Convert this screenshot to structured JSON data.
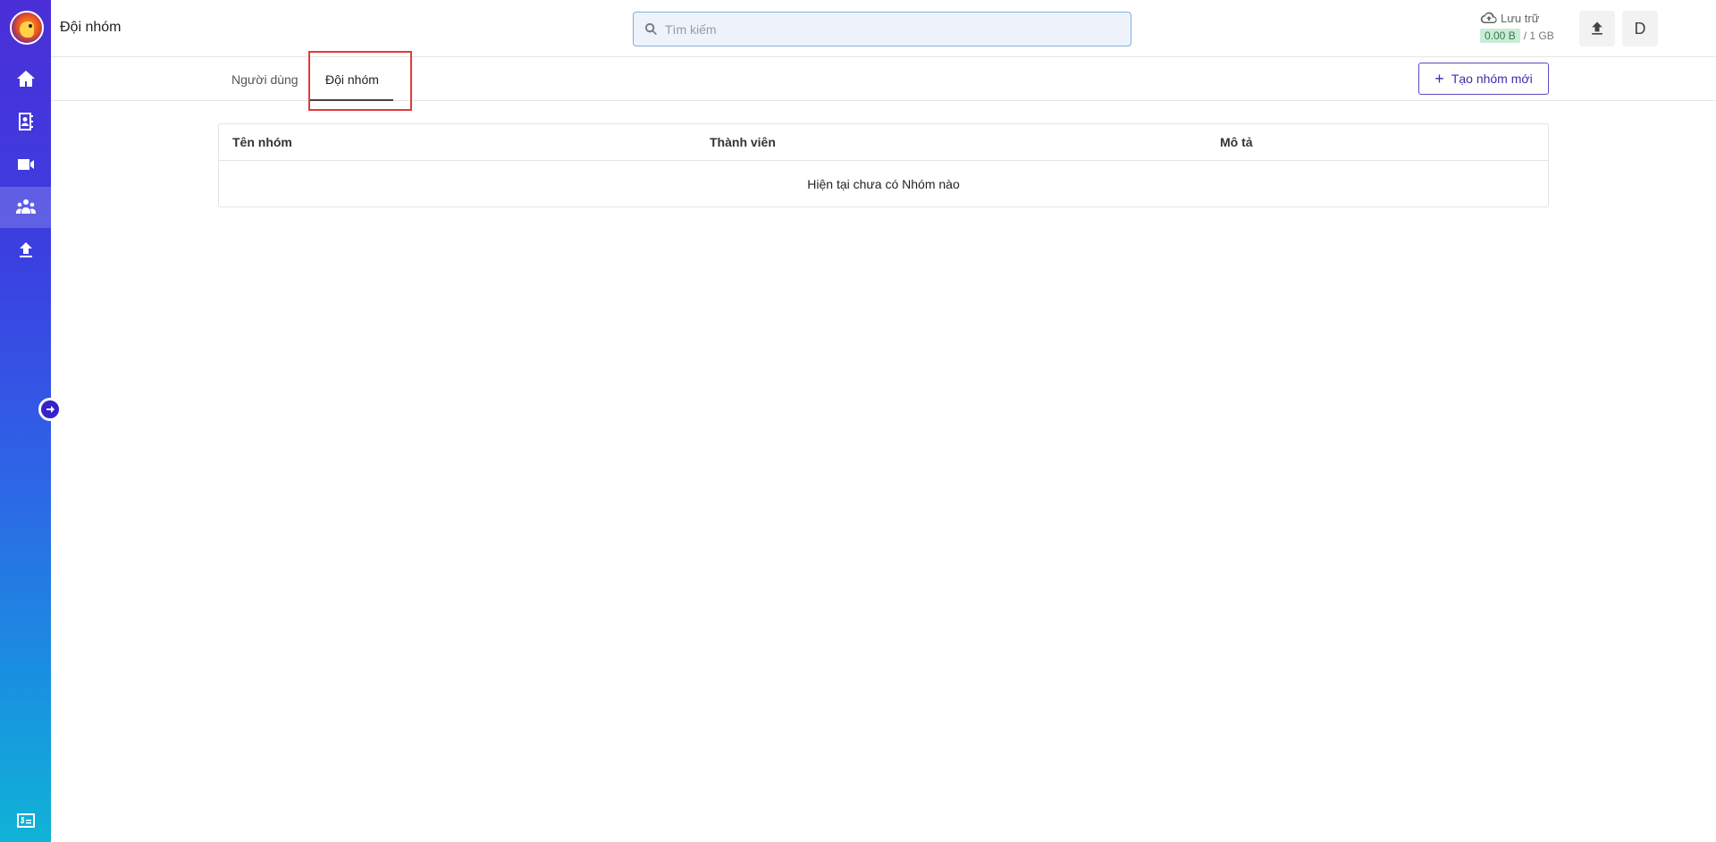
{
  "header": {
    "page_title": "Đội nhóm",
    "search_placeholder": "Tìm kiếm",
    "storage_label": "Lưu trữ",
    "storage_used": "0.00 B",
    "storage_total": "/ 1 GB",
    "avatar_letter": "D"
  },
  "sidebar": {
    "items": [
      {
        "icon": "home-icon"
      },
      {
        "icon": "contacts-icon"
      },
      {
        "icon": "video-camera-icon"
      },
      {
        "icon": "team-icon"
      },
      {
        "icon": "upload-icon"
      }
    ],
    "active_index": 3
  },
  "tabs": [
    {
      "label": "Người dùng"
    },
    {
      "label": "Đội nhóm"
    }
  ],
  "toolbar": {
    "create_label": "Tạo nhóm mới"
  },
  "table": {
    "columns": [
      "Tên nhóm",
      "Thành viên",
      "Mô tả"
    ],
    "empty_message": "Hiện tại chưa có Nhóm nào"
  },
  "colors": {
    "accent": "#3d2fa8",
    "highlight": "#e03a3a"
  }
}
